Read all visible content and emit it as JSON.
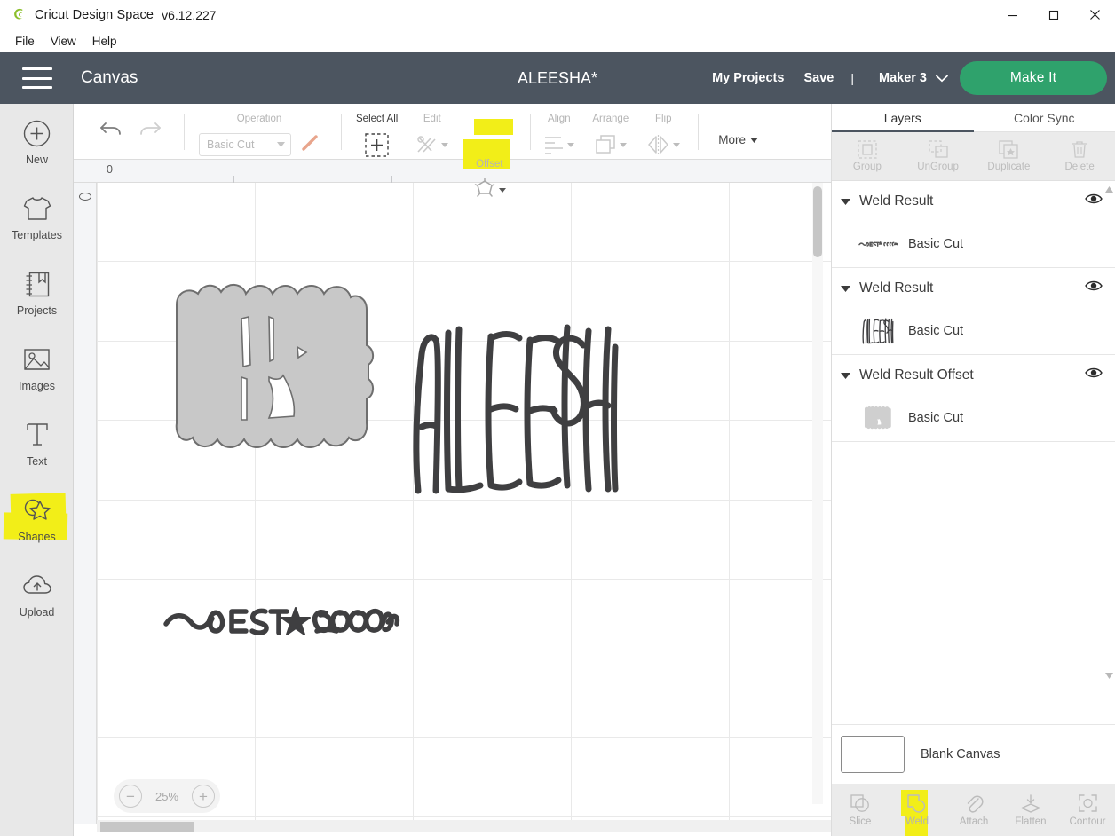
{
  "window": {
    "app_name": "Cricut Design Space",
    "version": "v6.12.227",
    "minimize_icon": "minimize-icon",
    "maximize_icon": "maximize-icon",
    "close_icon": "close-icon"
  },
  "menubar": {
    "items": [
      {
        "label": "File"
      },
      {
        "label": "View"
      },
      {
        "label": "Help"
      }
    ]
  },
  "header": {
    "menu_icon": "hamburger-icon",
    "canvas_label": "Canvas",
    "project_title": "ALEESHA*",
    "my_projects": "My Projects",
    "save": "Save",
    "separator": "|",
    "machine": "Maker 3",
    "machine_caret": "chevron-down-icon",
    "make_it": "Make It",
    "bg_color": "#4c5560",
    "accent_green": "#2fa26c"
  },
  "sidebar": {
    "items": [
      {
        "label": "New",
        "icon": "plus-circle-icon",
        "highlighted": false
      },
      {
        "label": "Templates",
        "icon": "tshirt-icon",
        "highlighted": false
      },
      {
        "label": "Projects",
        "icon": "bookmark-book-icon",
        "highlighted": false
      },
      {
        "label": "Images",
        "icon": "picture-icon",
        "highlighted": false
      },
      {
        "label": "Text",
        "icon": "text-t-icon",
        "highlighted": false
      },
      {
        "label": "Shapes",
        "icon": "shapes-star-icon",
        "highlighted": true
      },
      {
        "label": "Upload",
        "icon": "cloud-upload-icon",
        "highlighted": false
      }
    ],
    "highlight_color": "#f2ee18"
  },
  "toolbar": {
    "undo_icon": "undo-arrow-icon",
    "redo_icon": "redo-arrow-icon",
    "operation": {
      "caption": "Operation",
      "value": "Basic Cut",
      "caret_icon": "caret-down-icon",
      "color_swatch_icon": "line-color-icon",
      "disabled": true
    },
    "groups": [
      {
        "caption": "Select All",
        "icon": "select-all-icon",
        "enabled": true,
        "highlighted": false
      },
      {
        "caption": "Edit",
        "icon": "edit-scissors-icon",
        "enabled": false,
        "highlighted": false
      },
      {
        "caption": "Offset",
        "icon": "offset-shape-icon",
        "enabled": false,
        "highlighted": true
      },
      {
        "caption": "Align",
        "icon": "align-icon",
        "enabled": false,
        "highlighted": false
      },
      {
        "caption": "Arrange",
        "icon": "arrange-layers-icon",
        "enabled": false,
        "highlighted": false
      },
      {
        "caption": "Flip",
        "icon": "flip-icon",
        "enabled": false,
        "highlighted": false
      }
    ],
    "more": "More",
    "more_caret_icon": "caret-down-icon"
  },
  "ruler": {
    "top_origin_label": "0",
    "left_origin_icon": "origin-oval-icon"
  },
  "canvas": {
    "artwork": [
      {
        "name": "weld-result-offset-shape",
        "type": "offset-blob"
      },
      {
        "name": "aleesha-wordmark",
        "type": "text-art",
        "text": "ALEESHA"
      },
      {
        "name": "est-2000-swash",
        "type": "text-art",
        "text": "EST ★ 2000"
      }
    ],
    "zoom": {
      "minus_icon": "minus-icon",
      "value": "25%",
      "plus_icon": "plus-icon"
    }
  },
  "right_panel": {
    "tabs": [
      {
        "label": "Layers",
        "active": true
      },
      {
        "label": "Color Sync",
        "active": false
      }
    ],
    "actions": [
      {
        "label": "Group",
        "icon": "group-icon",
        "enabled": false
      },
      {
        "label": "UnGroup",
        "icon": "ungroup-icon",
        "enabled": false
      },
      {
        "label": "Duplicate",
        "icon": "duplicate-icon",
        "enabled": false
      },
      {
        "label": "Delete",
        "icon": "trash-icon",
        "enabled": false
      }
    ],
    "layers": [
      {
        "name": "Weld Result",
        "caret_icon": "caret-down-icon",
        "eye_icon": "eye-visible-icon",
        "child": {
          "label": "Basic Cut",
          "thumb": "est-2000-thumb"
        }
      },
      {
        "name": "Weld Result",
        "caret_icon": "caret-down-icon",
        "eye_icon": "eye-visible-icon",
        "child": {
          "label": "Basic Cut",
          "thumb": "aleesha-thumb"
        }
      },
      {
        "name": "Weld Result Offset",
        "caret_icon": "caret-down-icon",
        "eye_icon": "eye-visible-icon",
        "child": {
          "label": "Basic Cut",
          "thumb": "offset-blob-thumb"
        }
      }
    ],
    "canvas_row": {
      "label": "Blank Canvas",
      "swatch_color": "#ffffff"
    },
    "bottom_actions": [
      {
        "label": "Slice",
        "icon": "slice-icon",
        "enabled": false,
        "highlighted": false
      },
      {
        "label": "Weld",
        "icon": "weld-icon",
        "enabled": false,
        "highlighted": true
      },
      {
        "label": "Attach",
        "icon": "attach-paperclip-icon",
        "enabled": false,
        "highlighted": false
      },
      {
        "label": "Flatten",
        "icon": "flatten-icon",
        "enabled": false,
        "highlighted": false
      },
      {
        "label": "Contour",
        "icon": "contour-icon",
        "enabled": false,
        "highlighted": false
      }
    ]
  }
}
